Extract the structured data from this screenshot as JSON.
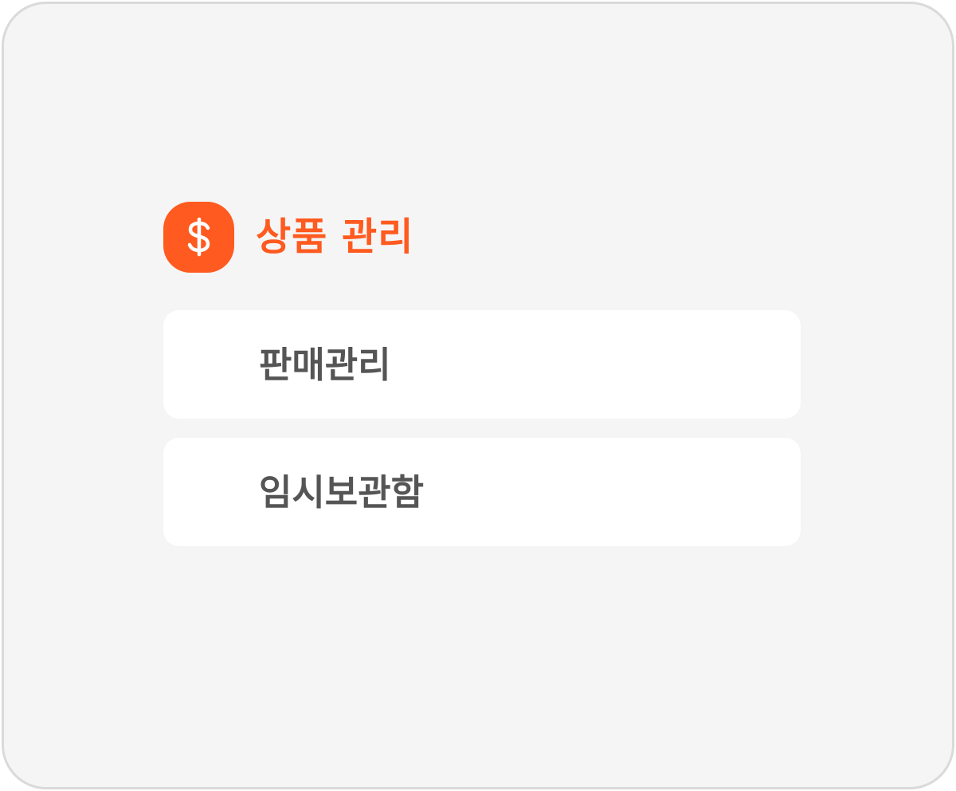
{
  "colors": {
    "accent": "#ff5a1f",
    "item_text": "#555555",
    "card_bg": "#f5f5f5",
    "item_bg": "#ffffff"
  },
  "header": {
    "icon": "dollar-sign-icon",
    "title": "상품 관리"
  },
  "menu": {
    "items": [
      {
        "label": "판매관리"
      },
      {
        "label": "임시보관함"
      }
    ]
  }
}
